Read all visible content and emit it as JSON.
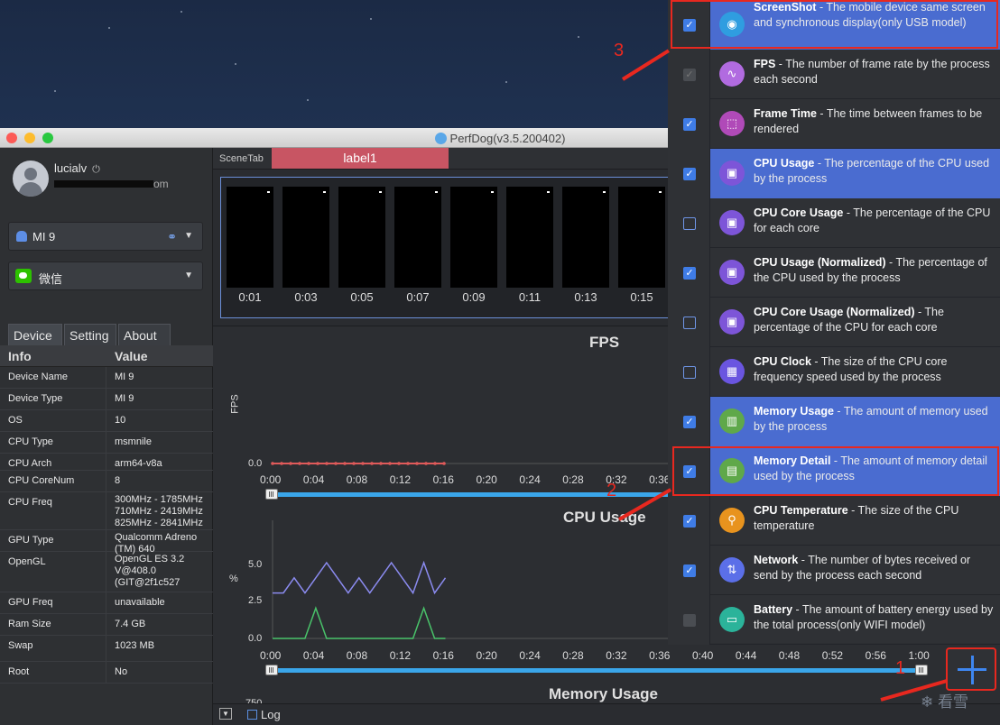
{
  "window": {
    "title": "PerfDog(v3.5.200402)"
  },
  "user": {
    "name": "lucialv",
    "email_tail": "om"
  },
  "device_dropdown": {
    "value": "MI 9"
  },
  "app_dropdown": {
    "value": "微信"
  },
  "tabs": [
    "Device",
    "Setting",
    "About"
  ],
  "info_table": {
    "headers": [
      "Info",
      "Value"
    ],
    "rows": [
      {
        "k": "Device Name",
        "v": "MI 9"
      },
      {
        "k": "Device Type",
        "v": "MI 9"
      },
      {
        "k": "OS",
        "v": "10"
      },
      {
        "k": "CPU Type",
        "v": "msmnile"
      },
      {
        "k": "CPU Arch",
        "v": "arm64-v8a"
      },
      {
        "k": "CPU CoreNum",
        "v": "8"
      },
      {
        "k": "CPU Freq",
        "v": "300MHz - 1785MHz\n710MHz - 2419MHz\n825MHz - 2841MHz"
      },
      {
        "k": "GPU Type",
        "v": "Qualcomm Adreno (TM) 640"
      },
      {
        "k": "OpenGL",
        "v": "OpenGL ES 3.2 V@408.0 (GIT@2f1c527"
      },
      {
        "k": "GPU Freq",
        "v": "unavailable"
      },
      {
        "k": "Ram Size",
        "v": "7.4 GB"
      },
      {
        "k": "Swap",
        "v": "1023 MB"
      },
      {
        "k": "Root",
        "v": "No"
      }
    ]
  },
  "scene": {
    "tab_label": "SceneTab",
    "label": "label1"
  },
  "screenshots": {
    "times": [
      "0:01",
      "0:03",
      "0:05",
      "0:07",
      "0:09",
      "0:11",
      "0:13",
      "0:15"
    ]
  },
  "fps_chart": {
    "title": "FPS",
    "ylabel": "FPS",
    "ytick": "0.0",
    "xticks": [
      "0:00",
      "0:04",
      "0:08",
      "0:12",
      "0:16",
      "0:20",
      "0:24",
      "0:28",
      "0:32",
      "0:36"
    ]
  },
  "cpu_chart": {
    "title": "CPU Usage",
    "ylabel": "%",
    "yticks": [
      "5.0",
      "2.5",
      "0.0"
    ],
    "xticks": [
      "0:00",
      "0:04",
      "0:08",
      "0:12",
      "0:16",
      "0:20",
      "0:24",
      "0:28",
      "0:32",
      "0:36",
      "0:40",
      "0:44",
      "0:48",
      "0:52",
      "0:56",
      "1:00"
    ]
  },
  "memory_chart": {
    "title": "Memory Usage",
    "ytick": "750"
  },
  "footer": {
    "log_label": "Log"
  },
  "colors": {
    "accent": "#3aa6ea",
    "selected_row": "#4a6cd0",
    "annotation": "#e8281f",
    "fps_line": "#e05a5a",
    "cpu_line_a": "#8b8bf0",
    "cpu_line_b": "#49c36a"
  },
  "panel_items": [
    {
      "name": "ScreenShot",
      "desc": " - The mobile device same screen and synchronous display(only USB model)",
      "state": "checked",
      "selected": true,
      "icon": "camera-icon",
      "icon_color": "#2f9de0",
      "glyph": "◉"
    },
    {
      "name": "FPS",
      "desc": " - The number of frame rate by the process each second",
      "state": "disabled",
      "selected": false,
      "icon": "pulse-icon",
      "icon_color": "#b16be0",
      "glyph": "∿"
    },
    {
      "name": "Frame Time",
      "desc": " - The time between frames to be rendered",
      "state": "checked",
      "selected": false,
      "icon": "frame-icon",
      "icon_color": "#b04ab8",
      "glyph": "⬚"
    },
    {
      "name": "CPU Usage",
      "desc": " - The percentage of the CPU used by the process",
      "state": "checked",
      "selected": true,
      "icon": "cpu-icon",
      "icon_color": "#7d55d8",
      "glyph": "▣"
    },
    {
      "name": "CPU Core Usage",
      "desc": " - The percentage of the CPU for each core",
      "state": "unchecked",
      "selected": false,
      "icon": "cpu-icon",
      "icon_color": "#7d55d8",
      "glyph": "▣"
    },
    {
      "name": "CPU Usage (Normalized)",
      "desc": " - The percentage of the CPU used by the process",
      "state": "checked",
      "selected": false,
      "icon": "cpu-icon",
      "icon_color": "#7d55d8",
      "glyph": "▣"
    },
    {
      "name": "CPU Core Usage (Normalized)",
      "desc": " - The percentage of the CPU for each core",
      "state": "unchecked",
      "selected": false,
      "icon": "cpu-icon",
      "icon_color": "#7d55d8",
      "glyph": "▣"
    },
    {
      "name": "CPU Clock",
      "desc": " - The size of the CPU core frequency speed used by the process",
      "state": "unchecked",
      "selected": false,
      "icon": "clock-chip-icon",
      "icon_color": "#6a55e0",
      "glyph": "▦"
    },
    {
      "name": "Memory Usage",
      "desc": " - The amount of memory used by the process",
      "state": "checked",
      "selected": true,
      "icon": "memory-icon",
      "icon_color": "#5fa84a",
      "glyph": "▥"
    },
    {
      "name": "Memory Detail",
      "desc": " - The amount of memory detail used by the process",
      "state": "checked",
      "selected": true,
      "icon": "memory-detail-icon",
      "icon_color": "#5fa84a",
      "glyph": "▤"
    },
    {
      "name": "CPU Temperature",
      "desc": " - The size of the CPU temperature",
      "state": "checked",
      "selected": false,
      "icon": "thermometer-icon",
      "icon_color": "#e8931e",
      "glyph": "⚲"
    },
    {
      "name": "Network",
      "desc": " - The number of bytes received or send by the process each second",
      "state": "checked",
      "selected": false,
      "icon": "network-icon",
      "icon_color": "#5b6fe8",
      "glyph": "⇅"
    },
    {
      "name": "Battery",
      "desc": " - The amount of battery energy used by the total process(only WIFI model)",
      "state": "disabled",
      "selected": false,
      "icon": "battery-icon",
      "icon_color": "#2bb39a",
      "glyph": "▭"
    }
  ],
  "annotations": {
    "n1": "1",
    "n2": "2",
    "n3": "3"
  },
  "watermark": "看雪"
}
